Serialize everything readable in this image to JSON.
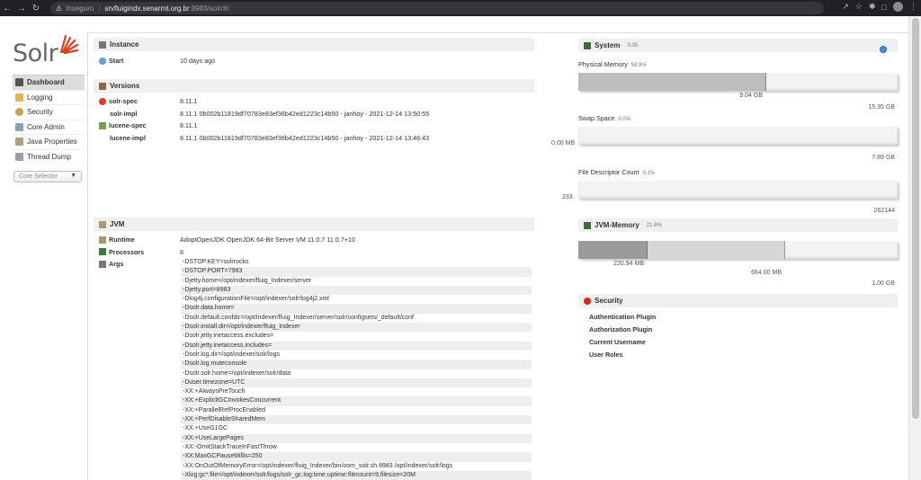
{
  "browser": {
    "security_label": "Inseguro",
    "url_host": "srvfluigindx.senarmt.org.br",
    "url_path": ":8983/solr/#/"
  },
  "logo": {
    "text": "Solr"
  },
  "sidebar": {
    "items": [
      {
        "label": "Dashboard",
        "active": true
      },
      {
        "label": "Logging"
      },
      {
        "label": "Security"
      },
      {
        "label": "Core Admin"
      },
      {
        "label": "Java Properties"
      },
      {
        "label": "Thread Dump"
      }
    ],
    "core_selector": "Core Selector"
  },
  "instance": {
    "title": "Instance",
    "start_label": "Start",
    "start_value": "10 days ago"
  },
  "versions": {
    "title": "Versions",
    "rows": [
      {
        "label": "solr-spec",
        "value": "8.11.1"
      },
      {
        "label": "solr-impl",
        "value": "8.11.1 0b002b11819df70783e83ef36b42ed1223c14b50 - janhoy - 2021-12-14 13:50:55"
      },
      {
        "label": "lucene-spec",
        "value": "8.11.1"
      },
      {
        "label": "lucene-impl",
        "value": "8.11.1 0b002b11819df70783e83ef36b42ed1223c14b50 - janhoy - 2021-12-14 13:46:43"
      }
    ]
  },
  "jvm": {
    "title": "JVM",
    "runtime_label": "Runtime",
    "runtime_value": "AdoptOpenJDK OpenJDK 64-Bit Server VM 11.0.7 11.0.7+10",
    "processors_label": "Processors",
    "processors_value": "8",
    "args_label": "Args",
    "args": [
      "-DSTOP.KEY=solrrocks",
      "-DSTOP.PORT=7983",
      "-Djetty.home=/opt/indexer/fluig_Indexer/server",
      "-Djetty.port=8983",
      "-Dlog4j.configurationFile=/opt/indexer/solr/log4j2.xml",
      "-Dsolr.data.home=",
      "-Dsolr.default.confdir=/opt/indexer/fluig_Indexer/server/solr/configsets/_default/conf",
      "-Dsolr.install.dir=/opt/indexer/fluig_Indexer",
      "-Dsolr.jetty.inetaccess.excludes=",
      "-Dsolr.jetty.inetaccess.includes=",
      "-Dsolr.log.dir=/opt/indexer/solr/logs",
      "-Dsolr.log.muteconsole",
      "-Dsolr.solr.home=/opt/indexer/solr/data",
      "-Duser.timezone=UTC",
      "-XX:+AlwaysPreTouch",
      "-XX:+ExplicitGCInvokesConcurrent",
      "-XX:+ParallelRefProcEnabled",
      "-XX:+PerfDisableSharedMem",
      "-XX:+UseG1GC",
      "-XX:+UseLargePages",
      "-XX:-OmitStackTraceInFastThrow",
      "-XX:MaxGCPauseMillis=250",
      "-XX:OnOutOfMemoryError=/opt/indexer/fluig_Indexer/bin/oom_solr.sh 8983 /opt/indexer/solr/logs",
      "-Xlog:gc*:file=/opt/indexer/solr/logs/solr_gc.log:time,uptime:filecount=9,filesize=20M"
    ]
  },
  "system": {
    "title": "System",
    "load": "0.00",
    "physical_memory": {
      "label": "Physical Memory",
      "pct": "58.9%",
      "fraction": 0.589,
      "used": "9.04 GB",
      "total": "15.35 GB"
    },
    "swap_space": {
      "label": "Swap Space",
      "pct": "0.0%",
      "fraction": 0.0,
      "used": "0.00 MB",
      "total": "7.89 GB"
    },
    "file_descriptor": {
      "label": "File Descriptor Count",
      "pct": "0.1%",
      "fraction": 0.001,
      "used": "233",
      "total": "262144"
    }
  },
  "jvm_memory": {
    "title": "JVM-Memory",
    "pct": "21.6%",
    "used": "220.94 MB",
    "used_fraction": 0.216,
    "committed": "664.00 MB",
    "committed_fraction": 0.649,
    "max": "1.00 GB"
  },
  "security": {
    "title": "Security",
    "items": [
      "Authentication Plugin",
      "Authorization Plugin",
      "Current Username",
      "User Roles"
    ]
  },
  "colors": {
    "bar_used": "#bdbdbd",
    "bar_used_dark": "#9b9b9b",
    "security_red": "#d9271e",
    "logo_red": "#d9411e"
  }
}
